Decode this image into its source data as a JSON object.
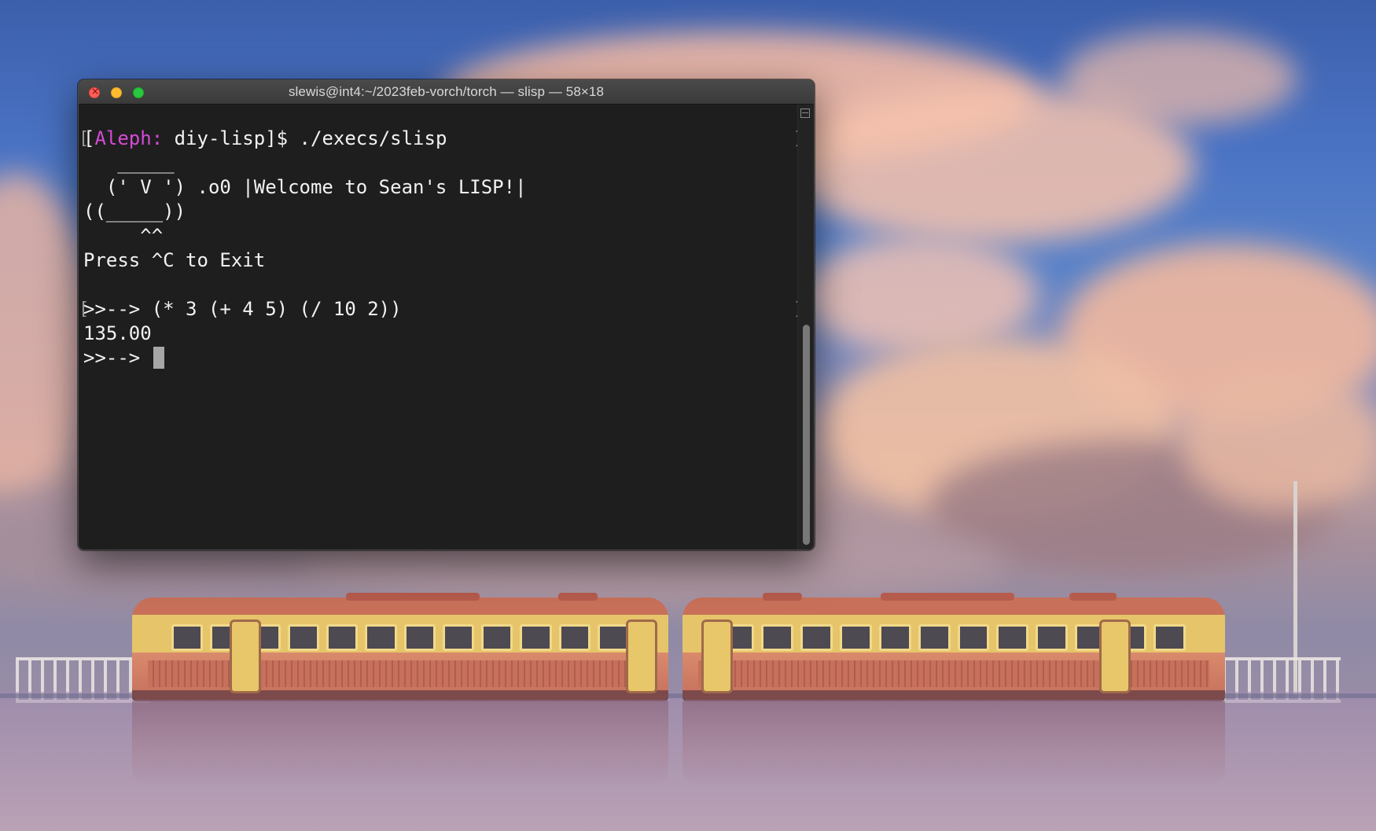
{
  "window": {
    "title": "slewis@int4:~/2023feb-vorch/torch — slisp — 58×18"
  },
  "terminal": {
    "prompt_open": "[",
    "prompt_host": "Aleph:",
    "prompt_rest": " diy-lisp]$ ./execs/slisp",
    "art_1": "   _____",
    " art_2": "",
    "art_line2": "  (' V ') .o0 |Welcome to Sean's LISP!|",
    "art_line3": "((_____))",
    "art_line4": "     ^^",
    "hint": "Press ^C to Exit",
    "input_line": ">>--> (* 3 (+ 4 5) (/ 10 2))",
    "result": "135.00",
    "current_prompt": ">>--> "
  },
  "theme": {
    "host_color": "#d64ad8",
    "terminal_bg": "#1e1e1e",
    "text_color": "#f2f2f2"
  },
  "icons": {
    "close": "close-icon",
    "minimize": "minimize-icon",
    "maximize": "maximize-icon",
    "split": "split-pane-icon"
  }
}
